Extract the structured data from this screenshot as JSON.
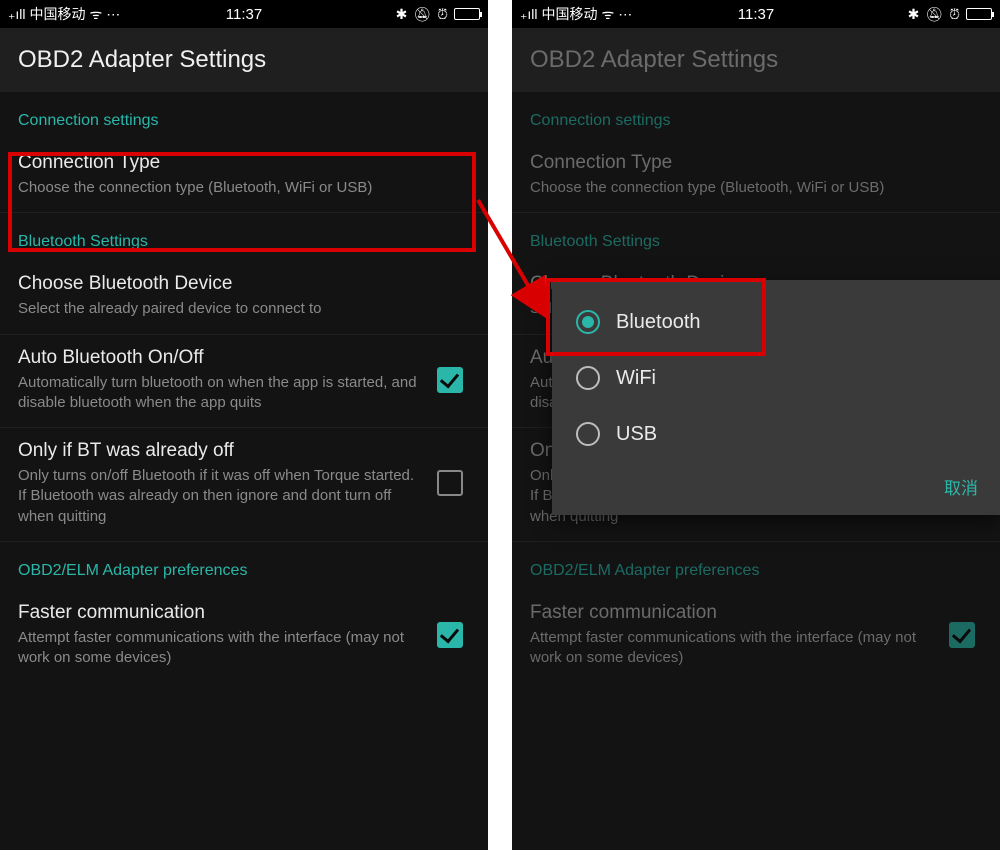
{
  "status": {
    "carrier": "中国移动",
    "time": "11:37"
  },
  "app_bar": {
    "title": "OBD2 Adapter Settings"
  },
  "sections": {
    "connection": {
      "header": "Connection settings",
      "connection_type": {
        "title": "Connection Type",
        "sub": "Choose the connection type (Bluetooth, WiFi or USB)"
      }
    },
    "bt": {
      "header": "Bluetooth Settings",
      "choose_device": {
        "title": "Choose Bluetooth Device",
        "sub": "Select the already paired device to connect to"
      },
      "auto_bt": {
        "title": "Auto Bluetooth On/Off",
        "sub": "Automatically turn bluetooth on when the app is started, and disable bluetooth when the app quits",
        "checked": true
      },
      "only_if_off": {
        "title": "Only if BT was already off",
        "sub": "Only turns on/off Bluetooth if it was off when Torque started. If Bluetooth was already on then ignore and dont turn off when quitting",
        "checked": false
      }
    },
    "obd": {
      "header": "OBD2/ELM Adapter preferences",
      "faster_comm": {
        "title": "Faster communication",
        "sub": "Attempt faster communications with the interface (may not work on some devices)",
        "checked": true
      }
    }
  },
  "dialog": {
    "options": [
      {
        "label": "Bluetooth",
        "selected": true
      },
      {
        "label": "WiFi",
        "selected": false
      },
      {
        "label": "USB",
        "selected": false
      }
    ],
    "cancel": "取消"
  }
}
